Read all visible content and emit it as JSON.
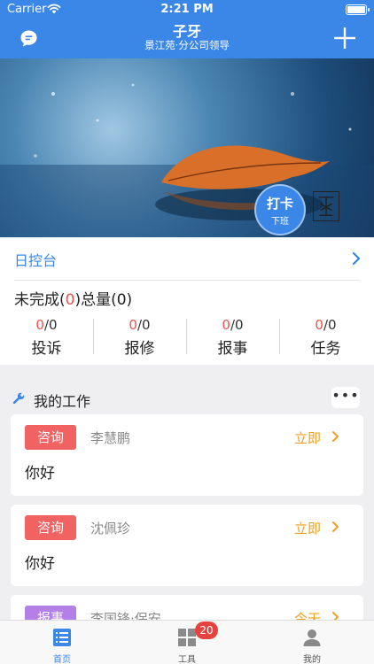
{
  "status_bar": {
    "carrier": "Carrier",
    "time": "2:21 PM"
  },
  "nav": {
    "title": "子牙",
    "subtitle": "景江苑·分公司领导"
  },
  "banner": {
    "punch_main": "打卡",
    "punch_sub": "下班"
  },
  "dashboard": {
    "title": "日控台",
    "summary": {
      "prefix": "未完成(",
      "unfinished": "0",
      "suffix": ")总量(0)"
    },
    "stats": [
      {
        "done": "0",
        "total": "/0",
        "label": "投诉"
      },
      {
        "done": "0",
        "total": "/0",
        "label": "报修"
      },
      {
        "done": "0",
        "total": "/0",
        "label": "报事"
      },
      {
        "done": "0",
        "total": "/0",
        "label": "任务"
      }
    ]
  },
  "work": {
    "title": "我的工作",
    "more": "•••",
    "items": [
      {
        "tag": "咨询",
        "name": "李慧鹏",
        "urgency": "立即",
        "content": "你好",
        "tag_color": "#f16262"
      },
      {
        "tag": "咨询",
        "name": "沈佩珍",
        "urgency": "立即",
        "content": "你好",
        "tag_color": "#f16262"
      },
      {
        "tag": "报事",
        "name": "李国锋·保安",
        "urgency": "今天",
        "content": "",
        "tag_color": "#b47fe6"
      }
    ]
  },
  "tabbar": {
    "items": [
      {
        "label": "首页",
        "icon": "list-icon",
        "active": true
      },
      {
        "label": "工具",
        "icon": "grid-icon",
        "badge": "20"
      },
      {
        "label": "我的",
        "icon": "person-icon"
      }
    ]
  },
  "colors": {
    "primary": "#3a87e8",
    "alert": "#e8544f",
    "urgency": "#f0a11b"
  }
}
